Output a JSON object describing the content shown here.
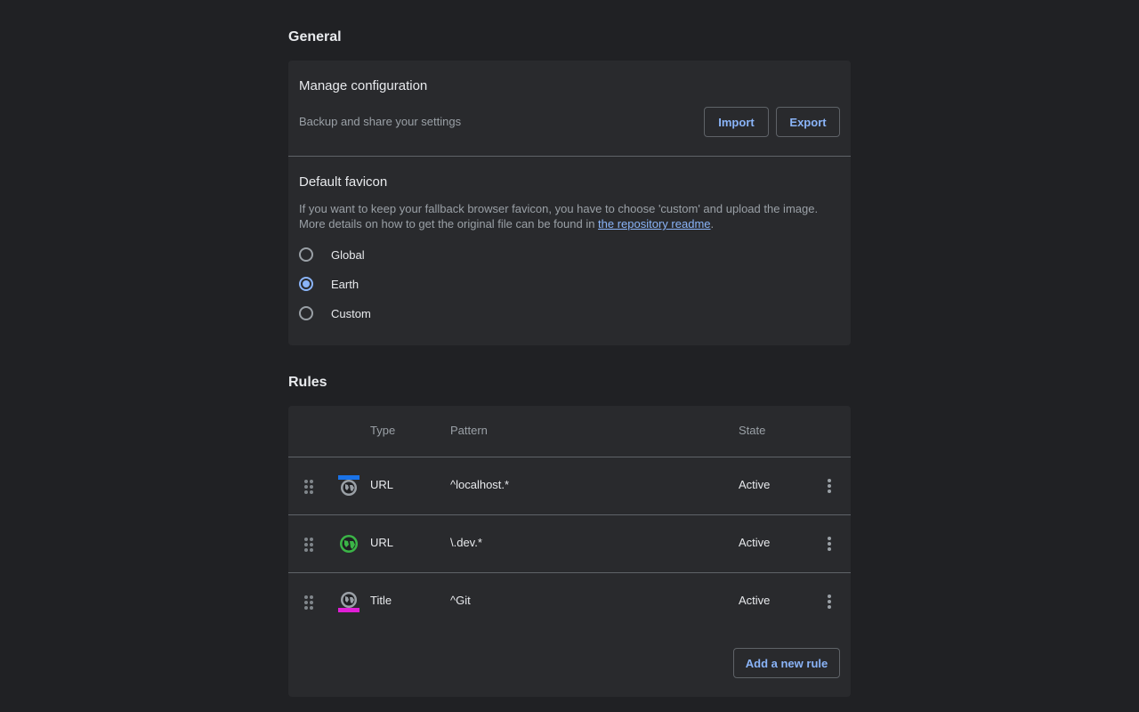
{
  "general": {
    "title": "General",
    "manage": {
      "title": "Manage configuration",
      "subtitle": "Backup and share your settings",
      "import_label": "Import",
      "export_label": "Export"
    },
    "favicon": {
      "title": "Default favicon",
      "desc_line1": "If you want to keep your fallback browser favicon, you have to choose 'custom' and upload the image.",
      "desc_line2_prefix": "More details on how to get the original file can be found in ",
      "desc_link": "the repository readme",
      "desc_line2_suffix": ".",
      "options": [
        {
          "label": "Global",
          "checked": false
        },
        {
          "label": "Earth",
          "checked": true
        },
        {
          "label": "Custom",
          "checked": false
        }
      ]
    }
  },
  "rules": {
    "title": "Rules",
    "columns": {
      "type": "Type",
      "pattern": "Pattern",
      "state": "State"
    },
    "rows": [
      {
        "type": "URL",
        "pattern": "^localhost.*",
        "state": "Active",
        "icon": "globe-icon-blue-top-bar"
      },
      {
        "type": "URL",
        "pattern": "\\.dev.*",
        "state": "Active",
        "icon": "globe-icon-green"
      },
      {
        "type": "Title",
        "pattern": "^Git",
        "state": "Active",
        "icon": "globe-icon-magenta-bottom-bar"
      }
    ],
    "add_label": "Add a new rule"
  },
  "colors": {
    "background": "#202124",
    "card": "#292a2d",
    "accent": "#8ab4f8",
    "bar_blue": "#1a73e8",
    "globe_green": "#3bb547",
    "bar_magenta": "#e01ed6"
  }
}
